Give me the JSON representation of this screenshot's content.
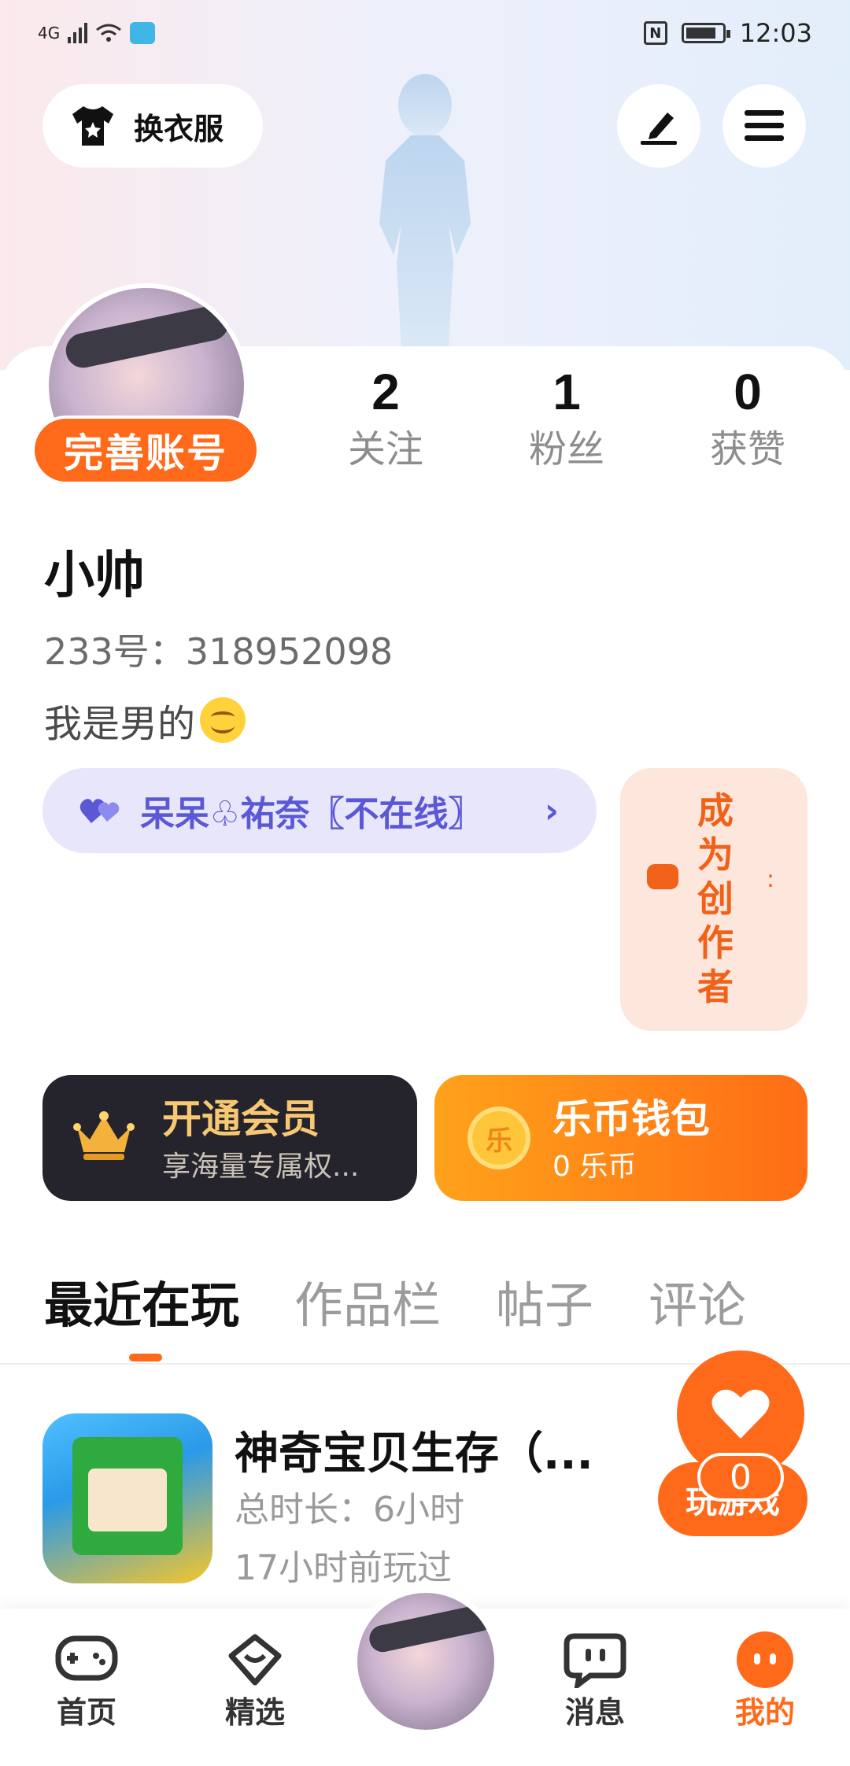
{
  "status_bar": {
    "network": "4G",
    "time": "12:03"
  },
  "header": {
    "outfit_label": "换衣服"
  },
  "profile": {
    "complete_account": "完善账号",
    "stats": [
      {
        "value": "2",
        "label": "关注"
      },
      {
        "value": "1",
        "label": "粉丝"
      },
      {
        "value": "0",
        "label": "获赞"
      }
    ],
    "username": "小帅",
    "id_text": "233号：318952098",
    "bio": "我是男的"
  },
  "partner": {
    "label": "呆呆♧祐奈〖不在线〗",
    "chevron": "›"
  },
  "creator": {
    "label": "成为创作者"
  },
  "vip": {
    "title": "开通会员",
    "subtitle": "享海量专属权..."
  },
  "wallet": {
    "title": "乐币钱包",
    "subtitle": "0 乐币",
    "coin_glyph": "乐"
  },
  "tabs": [
    {
      "label": "最近在玩",
      "active": true
    },
    {
      "label": "作品栏",
      "active": false
    },
    {
      "label": "帖子",
      "active": false
    },
    {
      "label": "评论",
      "active": false
    }
  ],
  "games": [
    {
      "title": "神奇宝贝生存（...",
      "duration": "总时长：6小时",
      "last_played": "17小时前玩过"
    }
  ],
  "play_button": "玩游戏",
  "like_fab": {
    "count": "0"
  },
  "bottom_nav": [
    {
      "label": "首页",
      "icon": "gamepad-icon",
      "active": false
    },
    {
      "label": "精选",
      "icon": "heart-chat-icon",
      "active": false
    },
    {
      "label": "消息",
      "icon": "message-icon",
      "active": false
    },
    {
      "label": "我的",
      "icon": "profile-face-icon",
      "active": true
    }
  ],
  "colors": {
    "accent": "#ff6a1a",
    "partner_text": "#5b58d6",
    "vip_gold": "#f7c873",
    "vip_bg": "#25232b"
  }
}
